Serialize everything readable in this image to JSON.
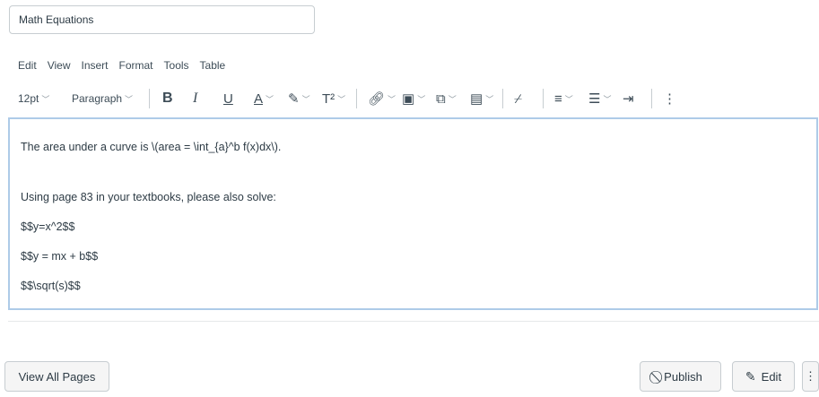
{
  "title_input": {
    "value": "Math Equations"
  },
  "menubar": [
    "Edit",
    "View",
    "Insert",
    "Format",
    "Tools",
    "Table"
  ],
  "toolbar": {
    "font_size": "12pt",
    "block_format": "Paragraph",
    "bold": "B",
    "italic": "I",
    "underline": "U",
    "text_color": "A",
    "superscript": "T²"
  },
  "editor": {
    "lines": [
      "The area under a curve is \\(area = \\int_{a}^b f(x)dx\\).",
      "Using page 83 in your textbooks, please also solve:",
      "$$y=x^2$$",
      "$$y = mx + b$$",
      "$$\\sqrt(s)$$"
    ]
  },
  "footer": {
    "view_all_pages": "View All Pages",
    "publish": "Publish",
    "edit": "Edit"
  },
  "colors": {
    "editor_focus_border": "#aecbe8",
    "text": "#2d3b45",
    "button_bg": "#f5f5f5"
  }
}
